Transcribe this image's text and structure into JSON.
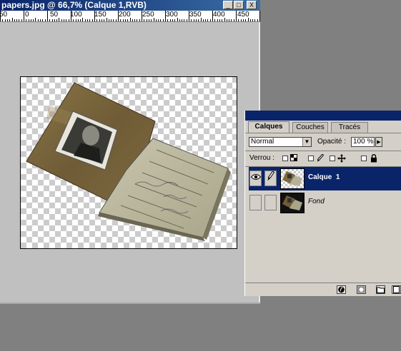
{
  "document": {
    "title": "papers.jpg @ 66,7% (Calque  1,RVB)",
    "window_buttons": {
      "minimize": "_",
      "maximize": "□",
      "close": "X"
    },
    "ruler_labels": [
      "50",
      "0",
      "50",
      "100",
      "150",
      "200",
      "250",
      "300",
      "350",
      "400",
      "450"
    ]
  },
  "layers_palette": {
    "tabs": [
      {
        "label": "Calques",
        "active": true
      },
      {
        "label": "Couches",
        "active": false
      },
      {
        "label": "Tracés",
        "active": false
      }
    ],
    "blend_mode": "Normal",
    "opacity_label": "Opacité :",
    "opacity_value": "100 %",
    "lock_label": "Verrou :",
    "layers": [
      {
        "name": "Calque  1",
        "selected": true,
        "visible": true
      },
      {
        "name": "Fond",
        "selected": false,
        "visible": false
      }
    ]
  },
  "icons": [
    "eye-icon",
    "brush-icon",
    "lock-icon",
    "move-icon",
    "paint-icon",
    "layer-style-icon",
    "mask-icon",
    "new-set-icon",
    "new-layer-icon"
  ]
}
